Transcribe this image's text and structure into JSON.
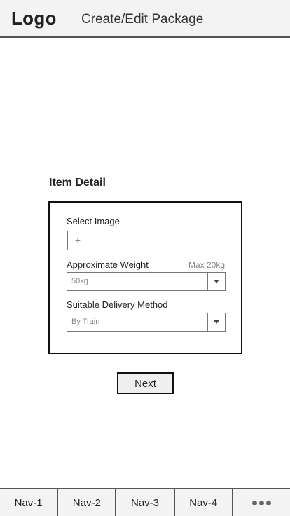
{
  "header": {
    "logo": "Logo",
    "title": "Create/Edit Package"
  },
  "item_detail": {
    "title": "Item Detail",
    "select_image_label": "Select Image",
    "add_image_glyph": "+",
    "weight_label": "Approximate Weight",
    "weight_hint": "Max 20kg",
    "weight_value": "50kg",
    "delivery_label": "Suitable Delivery Method",
    "delivery_value": "By Train"
  },
  "actions": {
    "next_label": "Next"
  },
  "nav": {
    "items": [
      "Nav-1",
      "Nav-2",
      "Nav-3",
      "Nav-4"
    ],
    "more_icon": "more-dots-icon"
  }
}
